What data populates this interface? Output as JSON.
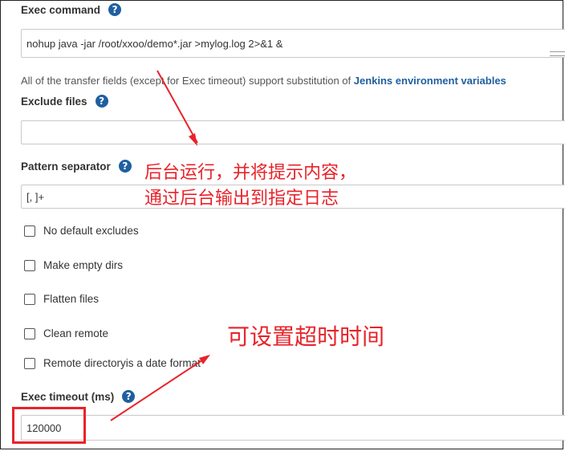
{
  "exec_command": {
    "label": "Exec command",
    "help_icon": "question-mark-icon",
    "value": "nohup java -jar /root/xxoo/demo*.jar >mylog.log 2>&1 &"
  },
  "transfer_help": {
    "text": "All of the transfer fields (except for Exec timeout) support substitution of ",
    "link": "Jenkins environment variables"
  },
  "exclude_files": {
    "label": "Exclude files",
    "help_icon": "question-mark-icon",
    "value": ""
  },
  "pattern_separator": {
    "label": "Pattern separator",
    "help_icon": "question-mark-icon",
    "value": "[, ]+"
  },
  "checkboxes": [
    {
      "label": "No default excludes",
      "checked": false
    },
    {
      "label": "Make empty dirs",
      "checked": false
    },
    {
      "label": "Flatten files",
      "checked": false
    },
    {
      "label": "Clean remote",
      "checked": false
    },
    {
      "label": "Remote directoryis a date format",
      "checked": false
    }
  ],
  "exec_timeout": {
    "label": "Exec timeout (ms)",
    "help_icon": "question-mark-icon",
    "value": "120000"
  },
  "annotations": {
    "note1_line1": "后台运行，并将提示内容，",
    "note1_line2": "通过后台输出到指定日志",
    "note2": "可设置超时时间",
    "color": "#e8232a"
  }
}
